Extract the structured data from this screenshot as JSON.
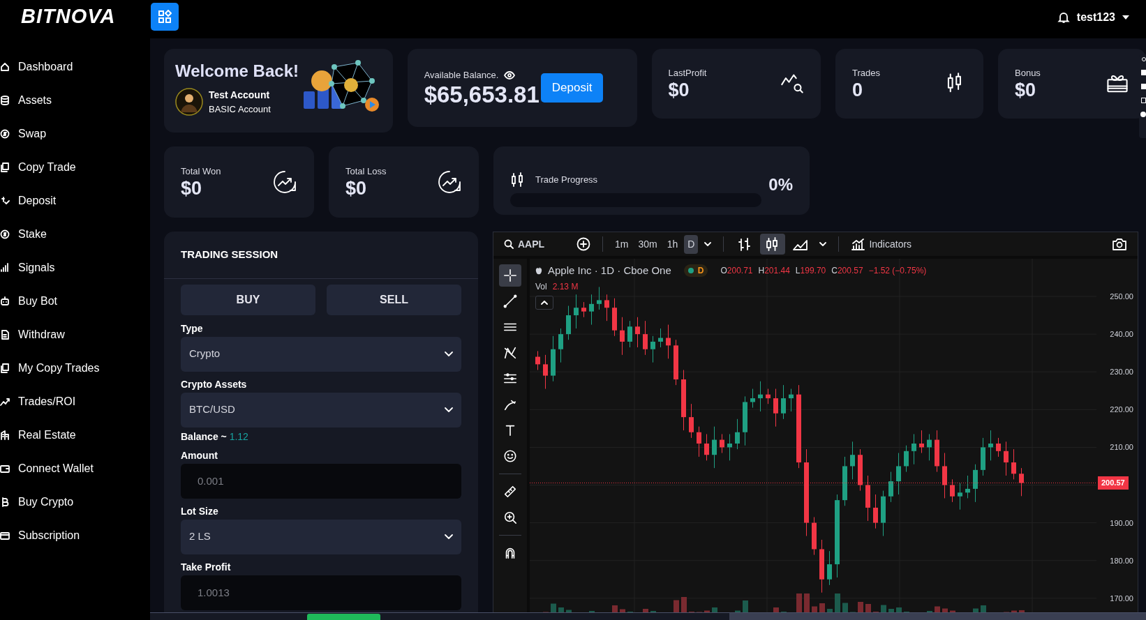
{
  "logo": "BITNOVA",
  "sidebar": {
    "items": [
      {
        "label": "Dashboard"
      },
      {
        "label": "Assets"
      },
      {
        "label": "Swap"
      },
      {
        "label": "Copy Trade"
      },
      {
        "label": "Deposit"
      },
      {
        "label": "Stake"
      },
      {
        "label": "Signals"
      },
      {
        "label": "Buy Bot"
      },
      {
        "label": "Withdraw"
      },
      {
        "label": "My Copy Trades"
      },
      {
        "label": "Trades/ROI"
      },
      {
        "label": "Real Estate"
      },
      {
        "label": "Connect Wallet"
      },
      {
        "label": "Buy Crypto"
      },
      {
        "label": "Subscription"
      }
    ]
  },
  "header": {
    "username": "test123"
  },
  "welcome": {
    "title": "Welcome Back!",
    "name": "Test Account",
    "account_type": "BASIC Account"
  },
  "balance": {
    "label": "Available Balance.",
    "value": "$65,653.81",
    "button": "Deposit"
  },
  "stats": [
    {
      "label": "LastProfit",
      "value": "$0"
    },
    {
      "label": "Trades",
      "value": "0"
    },
    {
      "label": "Bonus",
      "value": "$0"
    }
  ],
  "totals": [
    {
      "label": "Total Won",
      "value": "$0"
    },
    {
      "label": "Total Loss",
      "value": "$0"
    }
  ],
  "trade_progress": {
    "label": "Trade Progress",
    "level": 0,
    "reading": "0%"
  },
  "trading_session": {
    "title": "TRADING SESSION",
    "sides": [
      {
        "label": "BUY",
        "selected": false
      },
      {
        "label": "SELL",
        "selected": false
      }
    ],
    "fields": [
      {
        "kind": "select",
        "label": "Type",
        "value": "Crypto"
      },
      {
        "kind": "select",
        "label": "Crypto Assets",
        "value": "BTC/USD"
      },
      {
        "kind": "note",
        "label": "Balance ~",
        "value": "1.12"
      },
      {
        "kind": "input",
        "label": "Amount",
        "placeholder": "0.001"
      },
      {
        "kind": "select",
        "label": "Lot Size",
        "value": "2 LS"
      },
      {
        "kind": "input",
        "label": "Take Profit",
        "placeholder": "1.0013"
      }
    ]
  },
  "chart": {
    "symbol": "AAPL",
    "intervals": [
      {
        "label": "1m",
        "selected": false
      },
      {
        "label": "30m",
        "selected": false
      },
      {
        "label": "1h",
        "selected": false
      },
      {
        "label": "D",
        "selected": true
      }
    ],
    "chart_types": [
      {
        "selected": false
      },
      {
        "selected": true
      },
      {
        "selected": false
      }
    ],
    "indicators": "Indicators",
    "tools": [
      {
        "selected": true
      },
      {
        "selected": false
      },
      {
        "selected": false
      },
      {
        "selected": false
      },
      {
        "selected": false
      },
      {
        "selected": false
      },
      {
        "selected": false
      },
      {
        "selected": false
      },
      {
        "selected": false
      },
      {
        "selected": false
      },
      {
        "selected": false
      }
    ],
    "title": "Apple Inc · 1D · Cboe One",
    "badge": "D",
    "ohlc": [
      {
        "key": "O",
        "value": "200.71"
      },
      {
        "key": "H",
        "value": "201.44"
      },
      {
        "key": "L",
        "value": "199.70"
      },
      {
        "key": "C",
        "value": "200.57"
      }
    ],
    "change": "−1.52 (−0.75%)",
    "volume": {
      "label": "Vol",
      "value": "2.13 M"
    },
    "price_axis": [
      "250.00",
      "240.00",
      "230.00",
      "220.00",
      "210.00",
      "190.00",
      "180.00",
      "170.00"
    ],
    "last_price": "200.57"
  }
}
